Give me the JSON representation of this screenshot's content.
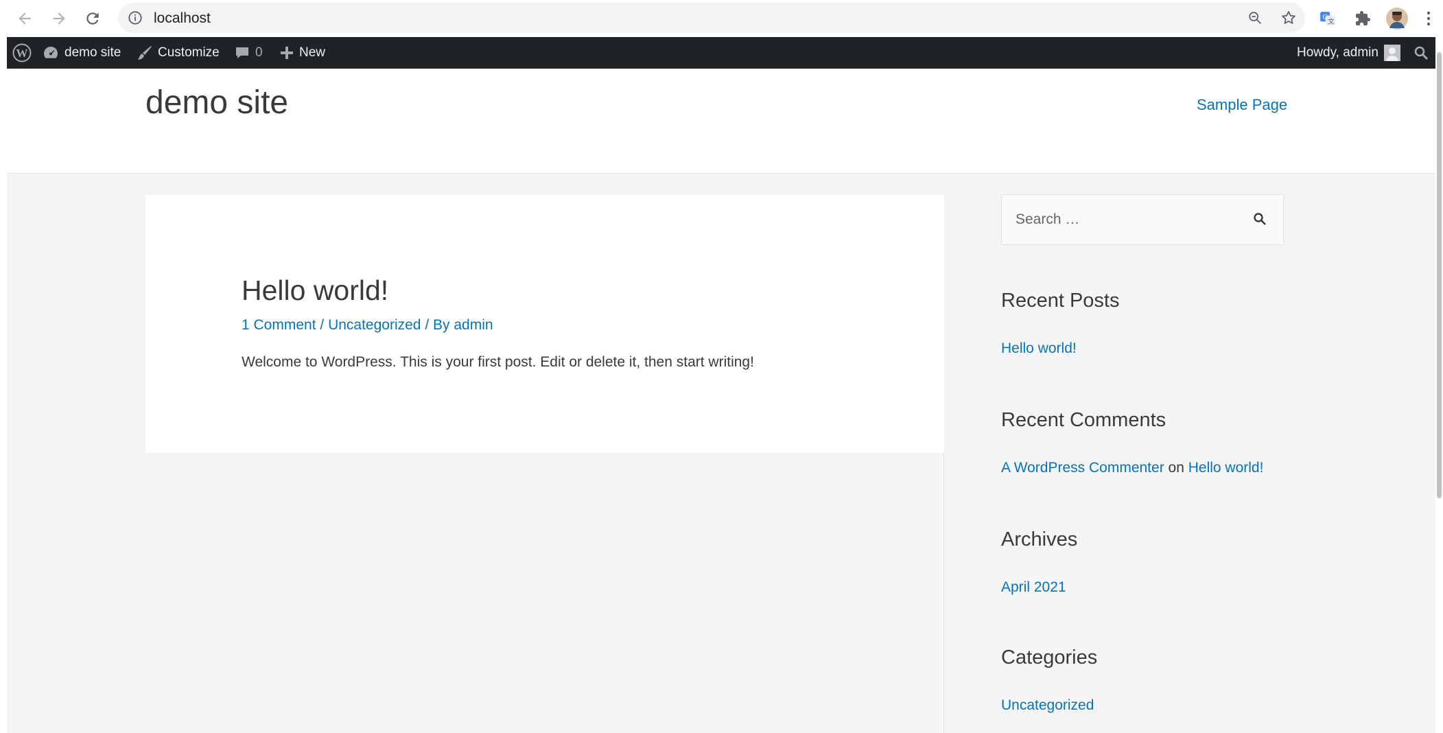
{
  "browser": {
    "url": "localhost"
  },
  "admin_bar": {
    "site_name": "demo site",
    "customize": "Customize",
    "comments_count": "0",
    "new": "New",
    "howdy": "Howdy, admin"
  },
  "header": {
    "site_title": "demo site",
    "menu": [
      "Sample Page"
    ]
  },
  "post": {
    "title": "Hello world!",
    "meta": {
      "comments": "1 Comment",
      "sep1": " / ",
      "category": "Uncategorized",
      "sep2": " / By ",
      "author": "admin"
    },
    "excerpt": "Welcome to WordPress. This is your first post. Edit or delete it, then start writing!"
  },
  "sidebar": {
    "search_placeholder": "Search …",
    "recent_posts": {
      "title": "Recent Posts",
      "items": [
        "Hello world!"
      ]
    },
    "recent_comments": {
      "title": "Recent Comments",
      "author": "A WordPress Commenter",
      "on": " on ",
      "post": "Hello world!"
    },
    "archives": {
      "title": "Archives",
      "items": [
        "April 2021"
      ]
    },
    "categories": {
      "title": "Categories",
      "items": [
        "Uncategorized"
      ]
    }
  },
  "colors": {
    "link": "#0274be",
    "admin_bar": "#1d2327",
    "page_bg": "#f5f5f5"
  }
}
